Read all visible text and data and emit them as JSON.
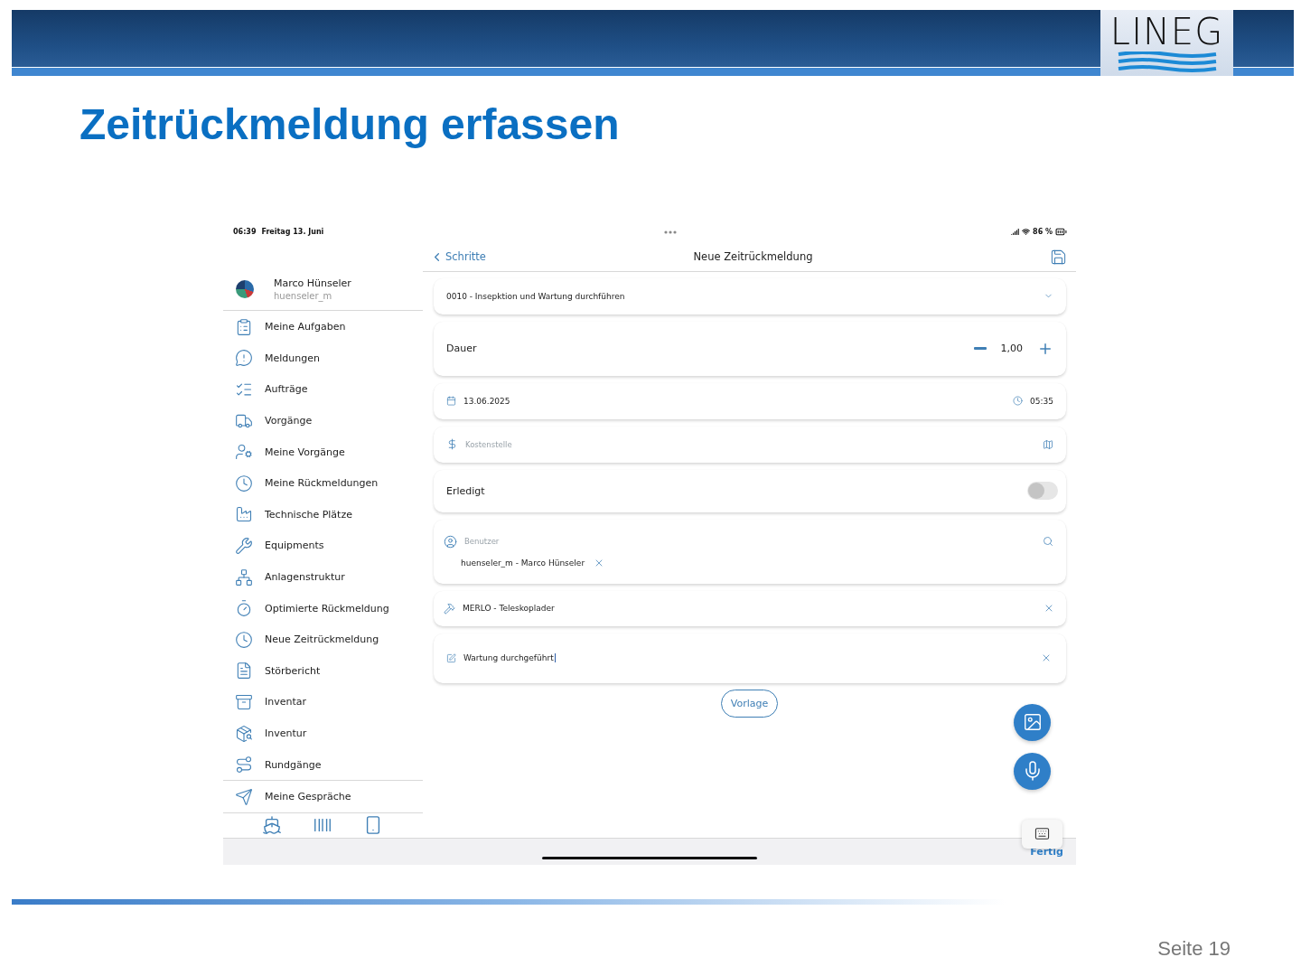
{
  "header": {
    "logo": "LINEG"
  },
  "slide": {
    "title": "Zeitrückmeldung erfassen",
    "page": "Seite 19"
  },
  "device": {
    "status_bar": {
      "time": "06:39",
      "date": "Freitag 13. Juni",
      "battery": "86 %"
    },
    "sidebar": {
      "user": {
        "name": "Marco Hünseler",
        "username": "huenseler_m"
      },
      "sections": [
        [
          "Meine Aufgaben",
          "Meldungen",
          "Aufträge",
          "Vorgänge",
          "Meine Vorgänge",
          "Meine Rückmeldungen",
          "Technische Plätze",
          "Equipments",
          "Anlagenstruktur",
          "Optimierte Rückmeldung",
          "Neue Zeitrückmeldung",
          "Störbericht",
          "Inventar",
          "Inventur",
          "Rundgänge"
        ],
        [
          "Meine Gespräche"
        ]
      ]
    },
    "nav": {
      "back": "Schritte",
      "title": "Neue Zeitrückmeldung"
    },
    "fields": [
      {
        "kind": "select",
        "value": "0010 - Insepktion und Wartung durchführen"
      },
      {
        "kind": "stepper",
        "label": "Dauer",
        "value": "1,00"
      },
      {
        "kind": "datetime",
        "date": "13.06.2025",
        "time": "05:35"
      },
      {
        "kind": "input",
        "placeholder": "Kostenstelle"
      },
      {
        "kind": "toggle",
        "label": "Erledigt",
        "on": false
      },
      {
        "kind": "picker",
        "placeholder": "Benutzer",
        "value": "huenseler_m - Marco Hünseler"
      },
      {
        "kind": "item",
        "value": "MERLO - Teleskoplader"
      },
      {
        "kind": "note",
        "value": "Wartung durchgeführt"
      }
    ],
    "template_button": "Vorlage",
    "keyboard_bar": {
      "done": "Fertig"
    }
  }
}
